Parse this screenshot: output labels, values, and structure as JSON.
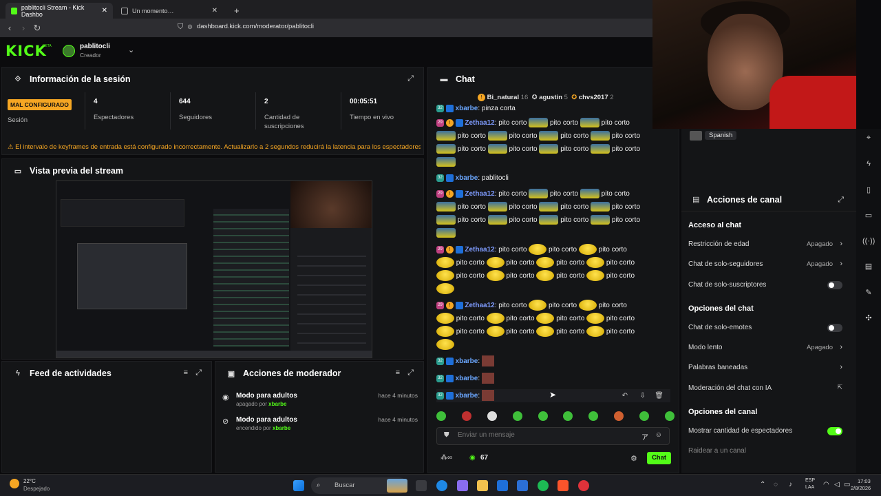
{
  "browser": {
    "tabs": [
      {
        "label": "pablitocli Stream - Kick Dashbo"
      },
      {
        "label": "Un momento…"
      }
    ],
    "url": "dashboard.kick.com/moderator/pablitocli"
  },
  "header": {
    "logo": "KICK",
    "logo_beta": "BETA",
    "username": "pablitocli",
    "role": "Creador"
  },
  "session": {
    "title": "Información de la sesión",
    "badge": "MAL CONFIGURADO",
    "badge_label": "Sesión",
    "stats": [
      {
        "value": "4",
        "label": "Espectadores"
      },
      {
        "value": "644",
        "label": "Seguidores"
      },
      {
        "value": "2",
        "label": "Cantidad de suscripciones"
      },
      {
        "value": "00:05:51",
        "label": "Tiempo en vivo"
      }
    ],
    "warning": "El intervalo de keyframes de entrada está configurado incorrectamente. Actualizarlo a 2 segundos reducirá la latencia para los espectadores"
  },
  "preview": {
    "title": "Vista previa del stream"
  },
  "feed": {
    "title": "Feed de actividades"
  },
  "mod_actions": {
    "title": "Acciones de moderador",
    "items": [
      {
        "title": "Modo para adultos",
        "sub": "apagado por",
        "user": "xbarbe",
        "time": "hace 4 minutos"
      },
      {
        "title": "Modo para adultos",
        "sub": "encendido por",
        "user": "xbarbe",
        "time": "hace 4 minutos"
      }
    ]
  },
  "chat": {
    "title": "Chat",
    "pinned": [
      {
        "name": "Bi_natural",
        "count": "16"
      },
      {
        "name": "agustin",
        "count": "5"
      },
      {
        "name": "chvs2017",
        "count": "2"
      }
    ],
    "top_line": {
      "user": "xbarbe",
      "text": ": pinza corta"
    },
    "messages": [
      {
        "user": "Zethaa12",
        "lines": [
          "pito corto",
          "pito corto",
          "pito corto"
        ],
        "rows": 3
      },
      {
        "user": "xbarbe",
        "text": ": pablitocli"
      },
      {
        "user": "Zethaa12",
        "rows": 3
      },
      {
        "user": "Zethaa12",
        "rows": 3
      },
      {
        "user": "Zethaa12",
        "rows": 3
      },
      {
        "user": "xbarbe"
      },
      {
        "user": "xbarbe"
      },
      {
        "user": "xbarbe"
      }
    ],
    "word": "pito corto",
    "input_placeholder": "Enviar un mensaje",
    "viewer_count": "67",
    "send_label": "Chat"
  },
  "webcam": {
    "language": "Spanish"
  },
  "channel_actions": {
    "title": "Acciones de canal",
    "sections": [
      {
        "heading": "Acceso al chat",
        "rows": [
          {
            "label": "Restricción de edad",
            "value": "Apagado",
            "type": "arrow"
          },
          {
            "label": "Chat de solo-seguidores",
            "value": "Apagado",
            "type": "arrow"
          },
          {
            "label": "Chat de solo-suscriptores",
            "type": "toggle",
            "on": false
          }
        ]
      },
      {
        "heading": "Opciones del chat",
        "rows": [
          {
            "label": "Chat de solo-emotes",
            "type": "toggle",
            "on": false
          },
          {
            "label": "Modo lento",
            "value": "Apagado",
            "type": "arrow"
          },
          {
            "label": "Palabras baneadas",
            "type": "arrow"
          },
          {
            "label": "Moderación del chat con IA",
            "type": "ext"
          }
        ]
      },
      {
        "heading": "Opciones del canal",
        "rows": [
          {
            "label": "Mostrar cantidad de espectadores",
            "type": "toggle",
            "on": true
          },
          {
            "label": "Raidear a un canal",
            "type": "plain"
          }
        ]
      }
    ]
  },
  "taskbar": {
    "weather_temp": "22°C",
    "weather_desc": "Despejado",
    "search_placeholder": "Buscar",
    "lang_top": "ESP",
    "lang_bottom": "LAA",
    "time": "17:03",
    "date": "2/8/2026"
  }
}
